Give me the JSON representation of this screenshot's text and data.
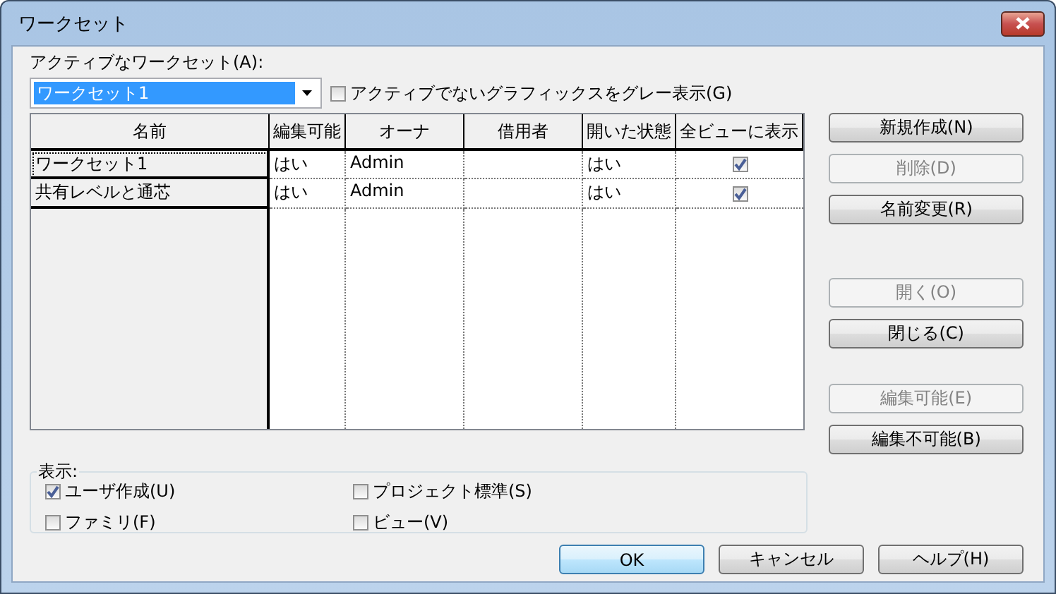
{
  "window": {
    "title": "ワークセット"
  },
  "active_workset": {
    "label": "アクティブなワークセット(A):",
    "value": "ワークセット1"
  },
  "gray_inactive": {
    "label": "アクティブでないグラフィックスをグレー表示(G)",
    "checked": false
  },
  "table": {
    "columns": [
      "名前",
      "編集可能",
      "オーナ",
      "借用者",
      "開いた状態",
      "全ビューに表示"
    ],
    "rows": [
      {
        "name": "ワークセット1",
        "editable": "はい",
        "owner": "Admin",
        "borrower": "",
        "open": "はい",
        "visible_in_all": true,
        "focused": true
      },
      {
        "name": "共有レベルと通芯",
        "editable": "はい",
        "owner": "Admin",
        "borrower": "",
        "open": "はい",
        "visible_in_all": true,
        "focused": false
      }
    ]
  },
  "button_groups": [
    [
      {
        "label": "新規作成(N)",
        "disabled": false
      },
      {
        "label": "削除(D)",
        "disabled": true
      },
      {
        "label": "名前変更(R)",
        "disabled": false
      }
    ],
    [
      {
        "label": "開く(O)",
        "disabled": true
      },
      {
        "label": "閉じる(C)",
        "disabled": false
      }
    ],
    [
      {
        "label": "編集可能(E)",
        "disabled": true
      },
      {
        "label": "編集不可能(B)",
        "disabled": false
      }
    ]
  ],
  "show": {
    "label": "表示:",
    "options": [
      {
        "label": "ユーザ作成(U)",
        "checked": true
      },
      {
        "label": "プロジェクト標準(S)",
        "checked": false
      },
      {
        "label": "ファミリ(F)",
        "checked": false
      },
      {
        "label": "ビュー(V)",
        "checked": false
      }
    ]
  },
  "dialog_buttons": [
    {
      "label": "OK",
      "default": true
    },
    {
      "label": "キャンセル",
      "default": false
    },
    {
      "label": "ヘルプ(H)",
      "default": false
    }
  ]
}
